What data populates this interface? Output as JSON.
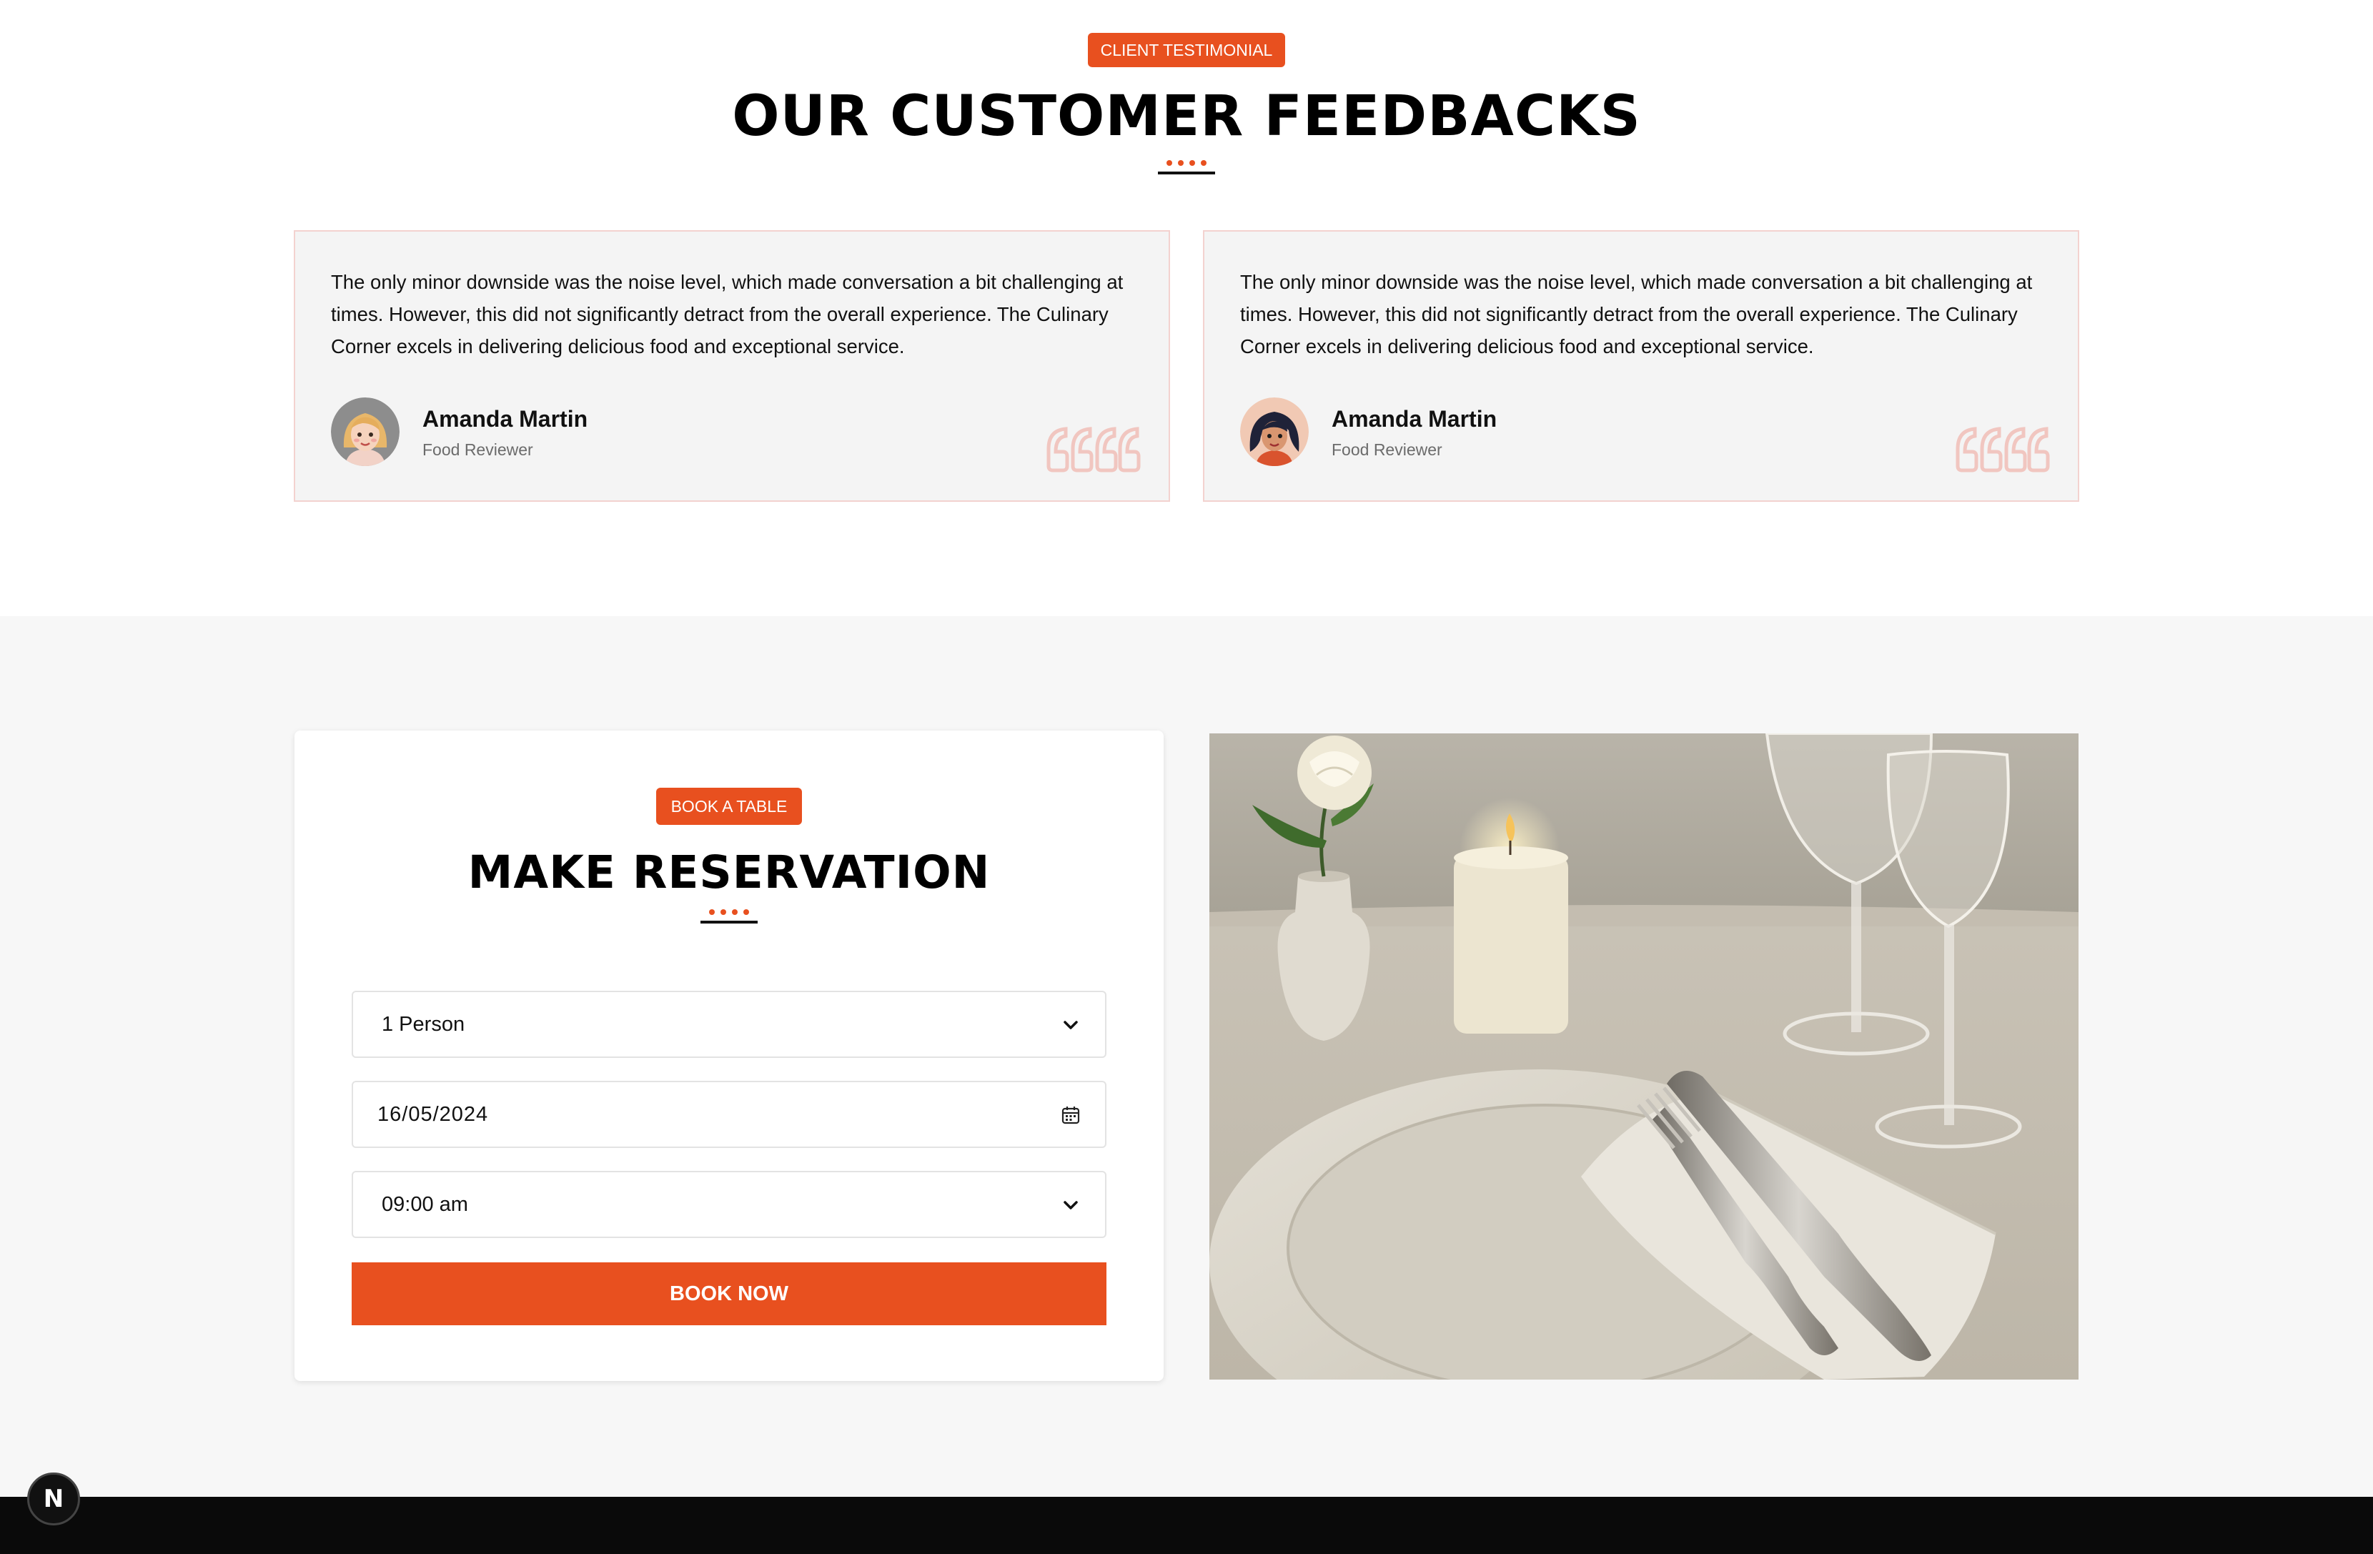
{
  "testimonials": {
    "badge": "CLIENT TESTIMONIAL",
    "title": "OUR CUSTOMER FEEDBACKS",
    "cards": [
      {
        "text": "The only minor downside was the noise level, which made conversation a bit challenging at times. However, this did not significantly detract from the overall experience. The Culinary Corner excels in delivering delicious food and exceptional service.",
        "name": "Amanda Martin",
        "role": "Food Reviewer",
        "avatar": "blonde-woman-avatar"
      },
      {
        "text": "The only minor downside was the noise level, which made conversation a bit challenging at times. However, this did not significantly detract from the overall experience. The Culinary Corner excels in delivering delicious food and exceptional service.",
        "name": "Amanda Martin",
        "role": "Food Reviewer",
        "avatar": "dark-haired-woman-avatar"
      }
    ]
  },
  "reservation": {
    "badge": "BOOK A TABLE",
    "title": "MAKE RESERVATION",
    "person": {
      "value": "1 Person"
    },
    "date": {
      "value": "16/05/2024"
    },
    "time": {
      "value": "09:00 am"
    },
    "button": "BOOK NOW",
    "image": "table-setting-photo"
  },
  "dev_badge": {
    "label": "N"
  },
  "colors": {
    "accent": "#e8501f",
    "card_bg": "#f4f4f4",
    "card_border": "#f3d2cf",
    "section_bg": "#f7f7f7",
    "footer_bg": "#0a0a0a"
  }
}
